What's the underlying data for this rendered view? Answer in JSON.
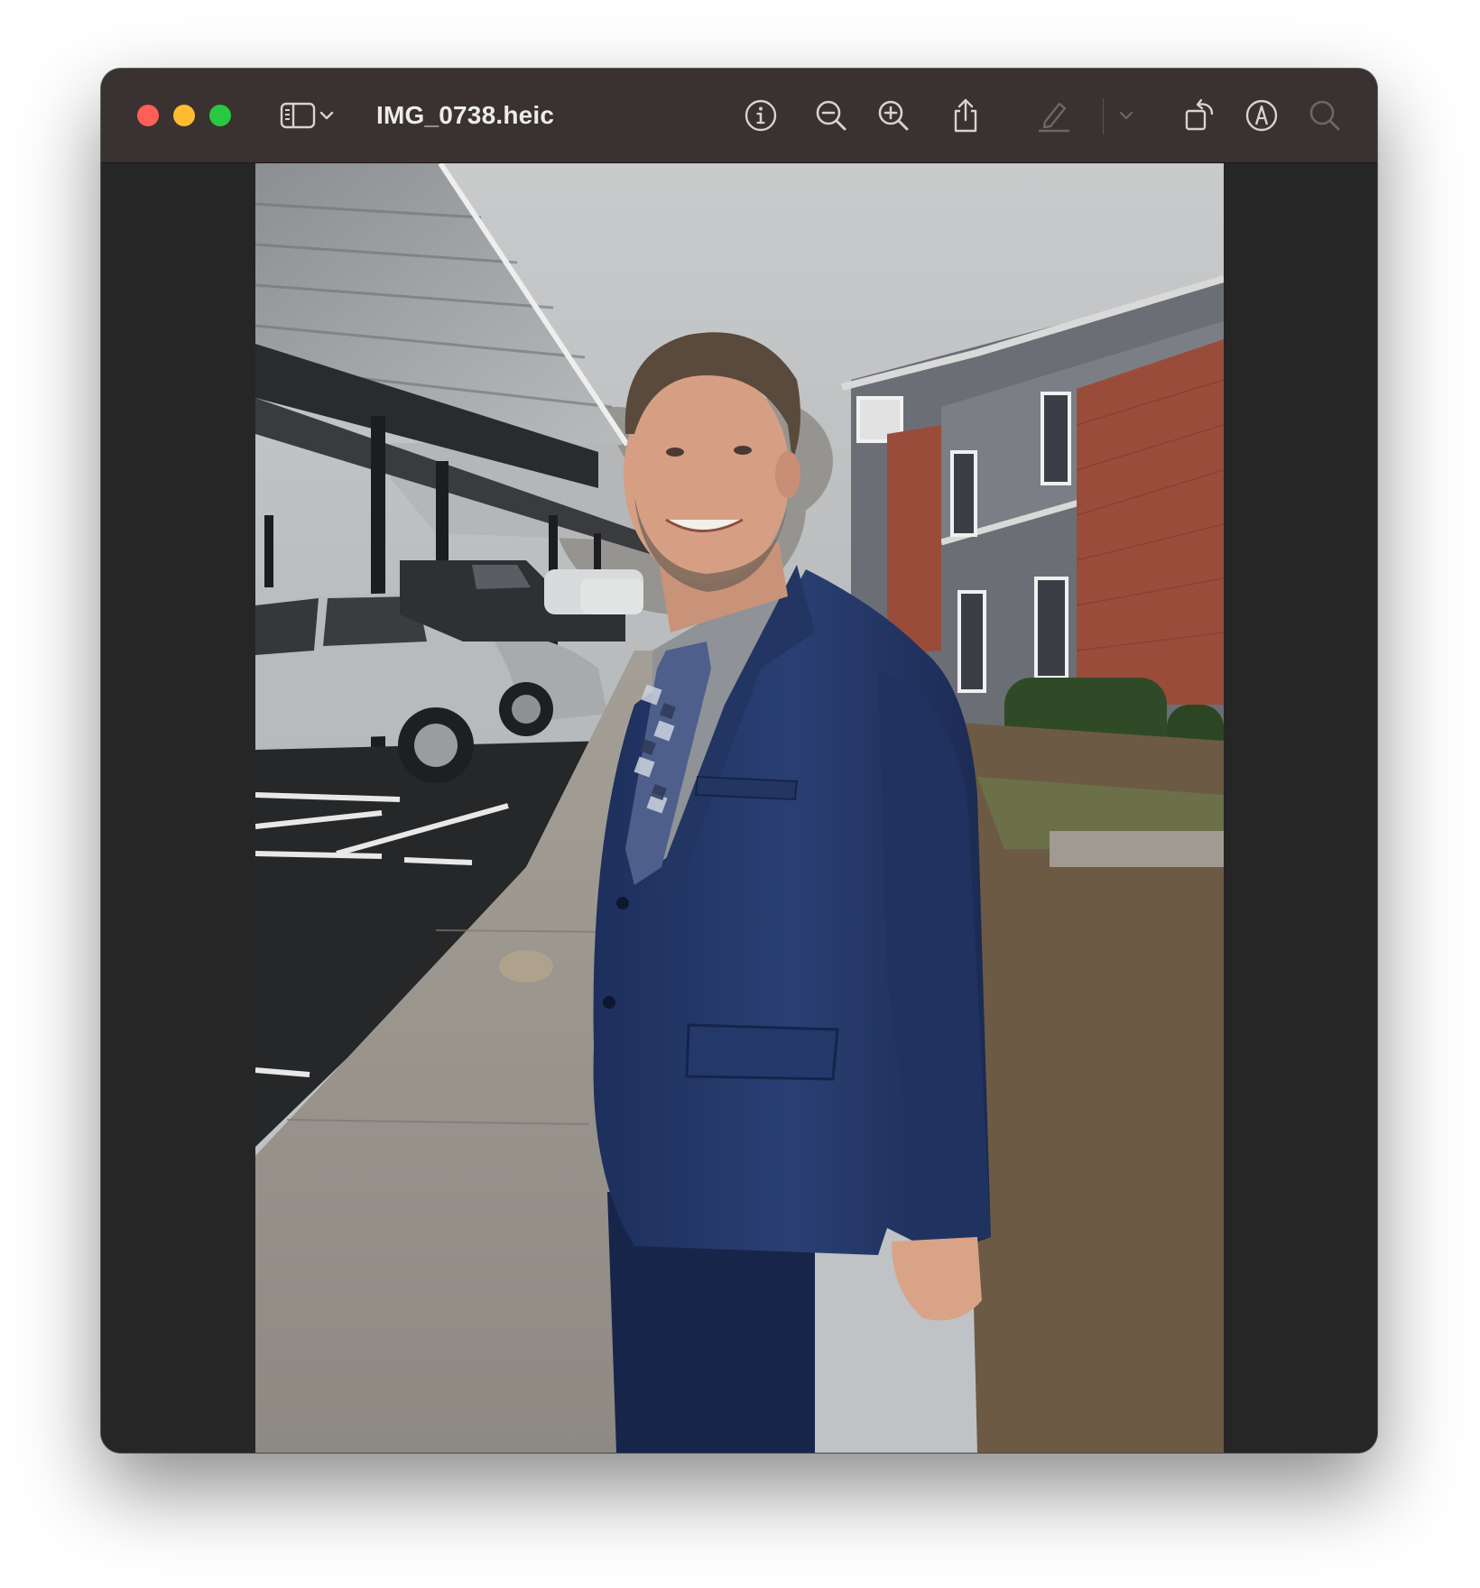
{
  "window": {
    "title": "IMG_0738.heic"
  },
  "traffic_lights": {
    "close": "close-window",
    "minimize": "minimize-window",
    "zoom": "zoom-window",
    "colors": {
      "close": "#ff5f57",
      "minimize": "#febc2e",
      "zoom": "#28c840"
    }
  },
  "toolbar": {
    "icons": [
      "sidebar-icon",
      "chevron-down-icon",
      "info-icon",
      "zoom-out-icon",
      "zoom-in-icon",
      "share-icon",
      "highlight-pen-icon",
      "chevron-down-icon",
      "rotate-icon",
      "markup-icon",
      "search-icon"
    ],
    "disabled_icons": [
      "highlight-pen-icon",
      "search-icon"
    ]
  },
  "colors": {
    "titlebar": "#3a3131",
    "background": "#262626",
    "icon": "#d8d2d2",
    "icon_disabled": "#6e6666"
  }
}
